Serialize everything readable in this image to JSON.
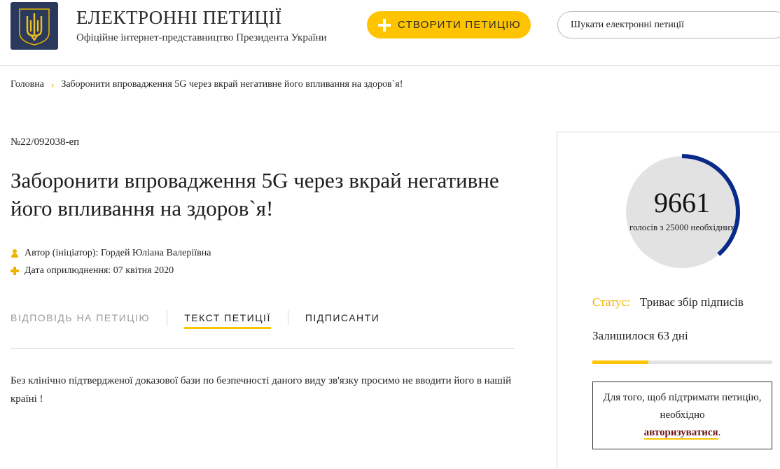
{
  "header": {
    "logo_icon": "trident-coat-of-arms-icon",
    "title": "ЕЛЕКТРОННІ ПЕТИЦІЇ",
    "subtitle": "Офіційне інтернет-представництво Президента України",
    "create_button": "СТВОРИТИ ПЕТИЦІЮ",
    "search_placeholder": "Шукати електронні петиції"
  },
  "breadcrumb": {
    "home": "Головна",
    "separator": "›",
    "current": "Заборонити впровадження 5G через вкрай негативне його впливання на здоров`я!"
  },
  "petition": {
    "number": "№22/092038-еп",
    "title": "Заборонити впровадження 5G через вкрай негативне його впливання на здоров`я!",
    "author_label": "Автор (ініціатор):",
    "author": "Гордей Юліана Валеріївна",
    "date_label": "Дата оприлюднення:",
    "date": "07 квітня 2020",
    "text": "Без клінічно підтвердженої доказової бази по безпечності даного виду зв'язку просимо не вводити його в нашій країні !"
  },
  "tabs": [
    {
      "label": "ВІДПОВІДЬ НА ПЕТИЦІЮ",
      "state": "inactive"
    },
    {
      "label": "ТЕКСТ ПЕТИЦІЇ",
      "state": "active"
    },
    {
      "label": "ПІДПИСАНТИ",
      "state": "normal"
    }
  ],
  "sidebar": {
    "votes": "9661",
    "votes_sub": "голосів з 25000 необхідних",
    "votes_current": 9661,
    "votes_needed": 25000,
    "status_label": "Статус:",
    "status_value": "Триває збір підписів",
    "remaining": "Залишилося 63 дні",
    "time_progress": 0.31,
    "login_text_1": "Для того, щоб підтримати петицію, необхідно",
    "login_link": "авторизуватися",
    "login_text_2": "."
  },
  "colors": {
    "accent": "#ffc400",
    "navy": "#2b3a5c",
    "ring": "#0a2a8a",
    "ring_track": "#e2e2e2",
    "link": "#6b1414"
  }
}
